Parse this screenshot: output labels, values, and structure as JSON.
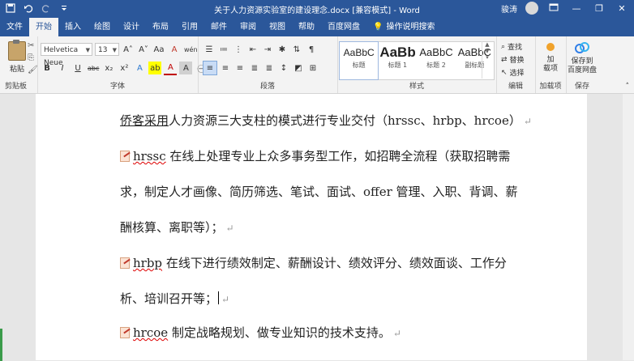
{
  "titlebar": {
    "doc_title": "关于人力资源实验室的建设理念.docx [兼容模式] - Word",
    "user": "骏涛",
    "icons": [
      "save-icon",
      "undo-icon",
      "redo-icon",
      "customize-icon"
    ]
  },
  "tabs": [
    "文件",
    "开始",
    "插入",
    "绘图",
    "设计",
    "布局",
    "引用",
    "邮件",
    "审阅",
    "视图",
    "帮助",
    "百度网盘"
  ],
  "active_tab": "开始",
  "tell_me": "操作说明搜索",
  "ribbon": {
    "clipboard": {
      "paste_label": "粘贴",
      "group_label": "剪贴板"
    },
    "font": {
      "font_name": "Helvetica Neue",
      "font_size": "13",
      "grow": "A˄",
      "shrink": "A˅",
      "case": "Aa",
      "clear": "A",
      "wen": "wén",
      "bold": "B",
      "italic": "I",
      "underline": "U",
      "strike": "abc",
      "subscript": "x₂",
      "superscript": "x²",
      "highlight": "ab",
      "font_color": "A",
      "shade": "A",
      "group_label": "字体"
    },
    "paragraph": {
      "group_label": "段落"
    },
    "styles": {
      "items": [
        {
          "preview": "AaBbC",
          "name": "标题",
          "size": "normal"
        },
        {
          "preview": "AaBb",
          "name": "标题 1",
          "size": "big"
        },
        {
          "preview": "AaBbC",
          "name": "标题 2",
          "size": "mid"
        },
        {
          "preview": "AaBbC",
          "name": "副标题",
          "size": "mid"
        }
      ],
      "group_label": "样式"
    },
    "editing": {
      "find": "查找",
      "replace": "替换",
      "select": "选择",
      "group_label": "编辑"
    },
    "addins": {
      "button_label_1": "加",
      "button_label_2": "载项",
      "group_label": "加载项"
    },
    "save": {
      "button_label_1": "保存到",
      "button_label_2": "百度网盘",
      "group_label": "保存"
    }
  },
  "document": {
    "line1_prefix": "侨客采用",
    "line1_rest": "人力资源三大支柱的模式进行专业交付（hrssc、hrbp、hrcoe）",
    "line2_term": "hrssc",
    "line2_rest": " 在线上处理专业上众多事务型工作，如招聘全流程（获取招聘需",
    "line3": "求，制定人才画像、简历筛选、笔试、面试、offer 管理、入职、背调、薪",
    "line4": "酬核算、离职等）；",
    "line5_term": "hrbp",
    "line5_rest": " 在线下进行绩效制定、薪酬设计、绩效评分、绩效面谈、工作分",
    "line6": "析、培训召开等；",
    "line7_term": "hrcoe",
    "line7_rest": " 制定战略规划、做专业知识的技术支持。",
    "para_mark": "↵"
  }
}
